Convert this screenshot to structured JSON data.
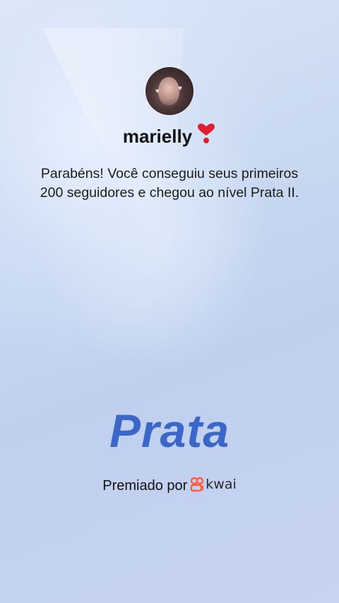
{
  "profile": {
    "username": "marielly",
    "name_emoji": "❣️"
  },
  "message": "Parabéns! Você conseguiu seus primeiros 200 seguidores e chegou ao nível Prata II.",
  "level": {
    "name": "Prata"
  },
  "award": {
    "prefix": "Premiado por",
    "brand": "kwai",
    "brand_icon": "kwai-logo-icon",
    "brand_color": "#ff5a3c"
  },
  "colors": {
    "level_text": "#3b68c8",
    "background": "#c9d9f1"
  }
}
